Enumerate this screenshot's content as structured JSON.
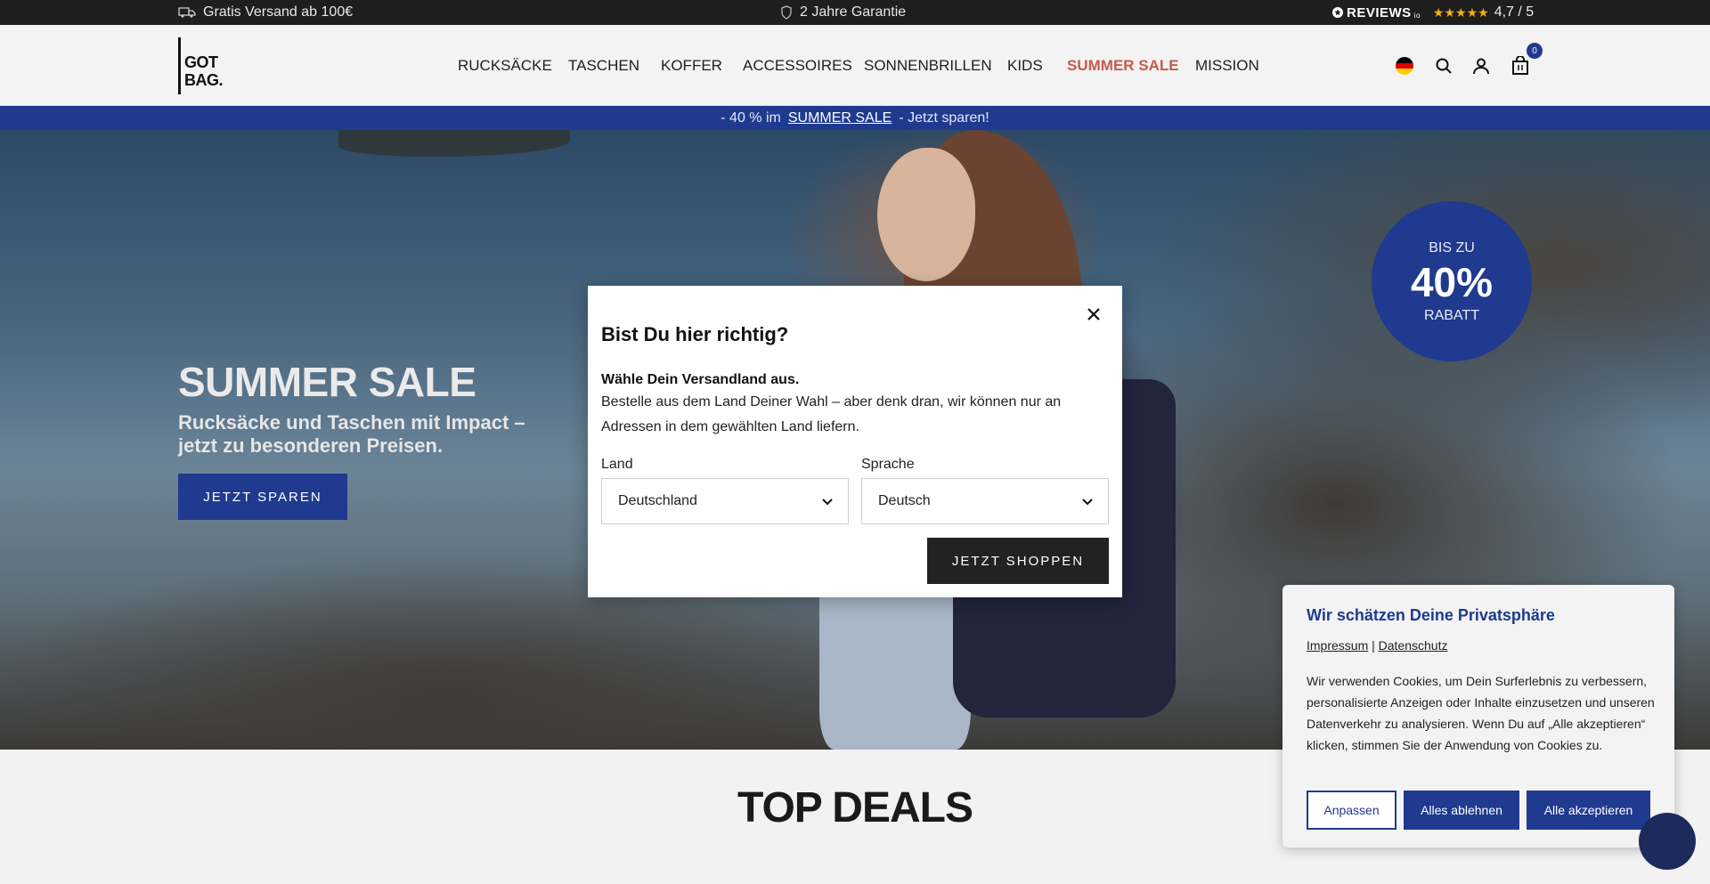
{
  "topbar": {
    "shipping": "Gratis Versand ab 100€",
    "warranty": "2 Jahre Garantie",
    "reviews_brand": "REVIEWS",
    "reviews_brand_suffix": "io",
    "stars": "★★★★★",
    "rating": "4,7 / 5"
  },
  "header": {
    "logo_line1": "GOT",
    "logo_line2": "BAG.",
    "nav": [
      "RUCKSÄCKE",
      "TASCHEN",
      "KOFFER",
      "ACCESSOIRES",
      "SONNENBRILLEN",
      "KIDS",
      "SUMMER SALE",
      "MISSION"
    ],
    "cart_count": "0"
  },
  "promobar": {
    "prefix": "- 40 % im",
    "link": "SUMMER SALE",
    "suffix": "- Jetzt sparen!"
  },
  "hero": {
    "title": "SUMMER SALE",
    "subtitle": "Rucksäcke und Taschen mit Impact – jetzt zu besonderen Preisen.",
    "button": "JETZT SPAREN",
    "badge_top": "BIS ZU",
    "badge_value": "40%",
    "badge_bottom": "RABATT"
  },
  "deals": {
    "title": "TOP DEALS"
  },
  "modal": {
    "title": "Bist Du hier richtig?",
    "lead": "Wähle Dein Versandland aus.",
    "text": "Bestelle aus dem Land Deiner Wahl – aber denk dran, wir können nur an Adressen in dem gewählten Land liefern.",
    "country_label": "Land",
    "country_value": "Deutschland",
    "language_label": "Sprache",
    "language_value": "Deutsch",
    "button": "JETZT SHOPPEN"
  },
  "cookie": {
    "title": "Wir schätzen Deine Privatsphäre",
    "link_impressum": "Impressum",
    "link_separator": "|",
    "link_datenschutz": "Datenschutz",
    "text": "Wir verwenden Cookies, um Dein Surferlebnis zu verbessern, personalisierte Anzeigen oder Inhalte einzusetzen und unseren Datenverkehr zu analysieren. Wenn Du auf „Alle akzeptieren“ klicken, stimmen Sie der Anwendung von Cookies zu.",
    "btn_customize": "Anpassen",
    "btn_reject": "Alles ablehnen",
    "btn_accept": "Alle akzeptieren"
  },
  "colors": {
    "brand_blue": "#1f3a8f",
    "sale_red": "#c9584e",
    "dark": "#1e1e1e"
  },
  "icons": [
    "truck-icon",
    "shield-icon",
    "reviews-logo-icon",
    "germany-flag-icon",
    "search-icon",
    "user-icon",
    "shopping-bag-icon",
    "close-icon",
    "chevron-down-icon",
    "chat-icon"
  ]
}
